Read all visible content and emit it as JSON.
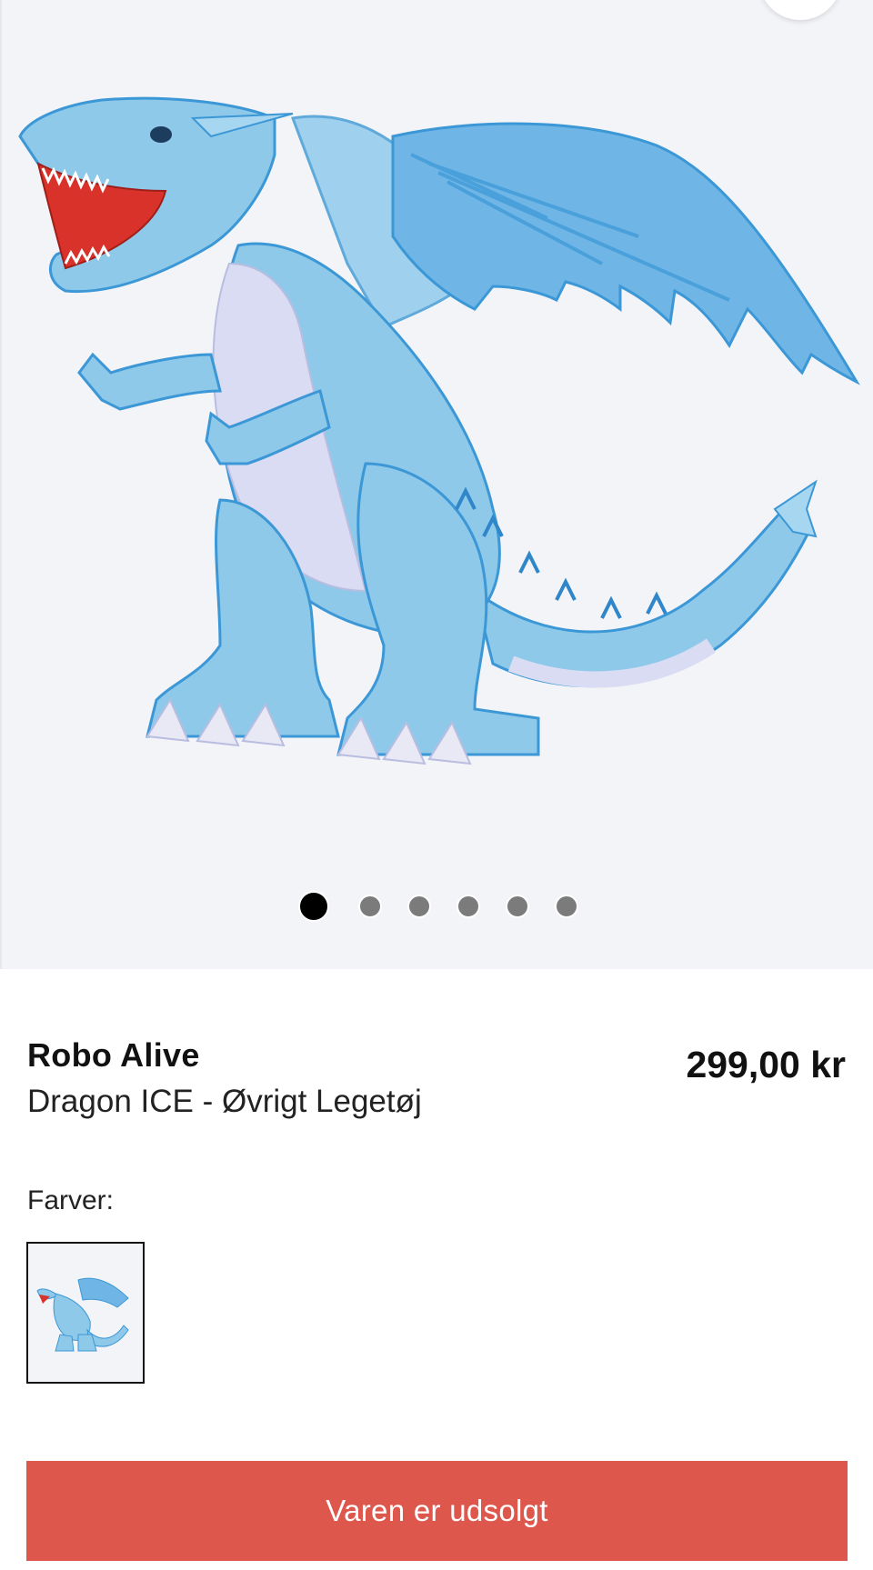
{
  "product": {
    "brand": "Robo Alive",
    "name": "Dragon ICE - Øvrigt Legetøj",
    "price": "299,00 kr",
    "image_icon": "blue-dragon-toy-image"
  },
  "gallery": {
    "slides": 6,
    "active_slide": 1
  },
  "colors": {
    "label": "Farver:",
    "swatches": [
      {
        "icon": "blue-dragon-thumbnail",
        "selected": true
      }
    ]
  },
  "cta": {
    "label": "Varen er udsolgt",
    "color": "#de574d"
  },
  "theme": {
    "gallery_bg": "#f2f4f7",
    "dragon_main": "#8ec9ea",
    "dragon_dark": "#3c97d6",
    "dragon_belly": "#d9dcf2",
    "mouth": "#d9322b"
  }
}
